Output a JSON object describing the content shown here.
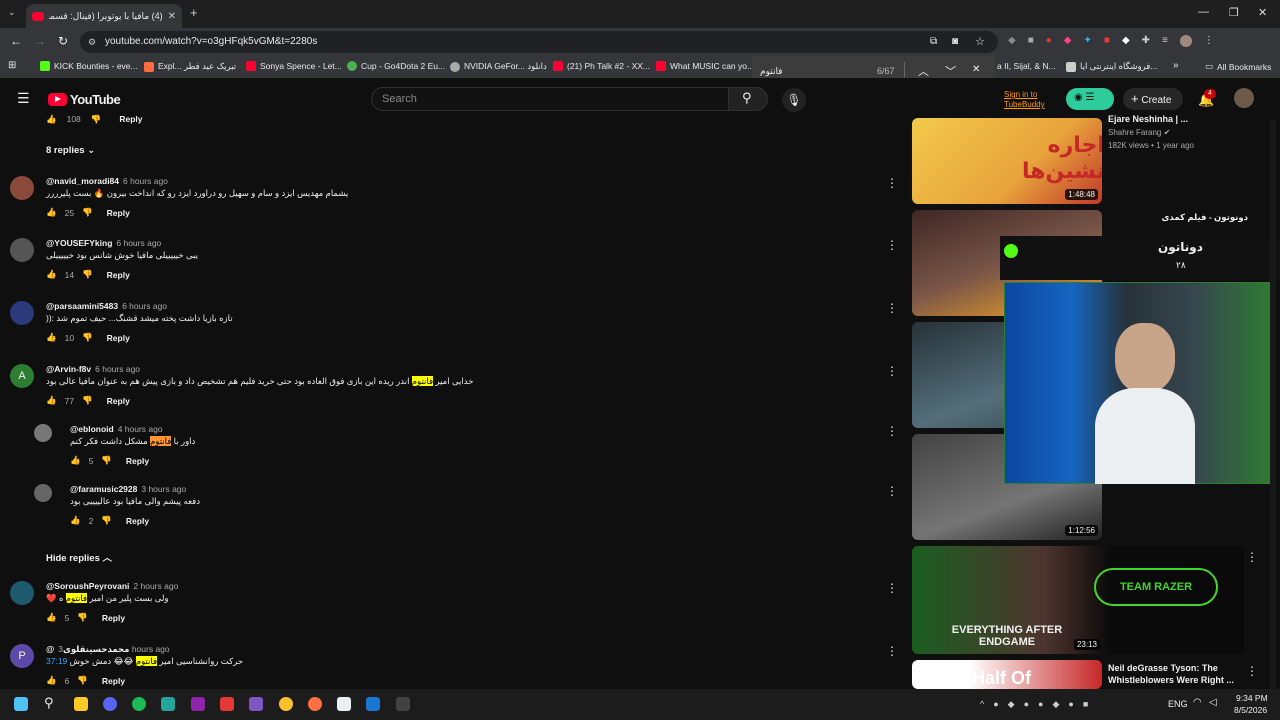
{
  "browser": {
    "tab_title": "(4) مافیا با یوتوبرا (فینال: قسمت آ...",
    "url": "youtube.com/watch?v=o3gHFqk5vGM&t=2280s",
    "bookmarks": [
      {
        "label": "KICK Bounties - eve...",
        "color": "#53fc18"
      },
      {
        "label": "Expl... تبریک عید فطر",
        "color": "#ff6b3d"
      },
      {
        "label": "Sonya Spence - Let...",
        "color": "#ff0033"
      },
      {
        "label": "Cup - Go4Dota 2 Eu...",
        "color": "#4caf50"
      },
      {
        "label": "NVIDIA GeFor... دانلود",
        "color": "#aaaaaa"
      },
      {
        "label": "(21) Ph Talk #2 - XX...",
        "color": "#ff0033"
      },
      {
        "label": "What MUSIC can yo...",
        "color": "#ff0033"
      },
      {
        "label": "a II, Sijal, & N...",
        "color": "#cccccc"
      },
      {
        "label": "فروشگاه اینترنتی ایا...",
        "color": "#cccccc"
      }
    ],
    "all_bookmarks": "All Bookmarks",
    "find": {
      "query": "فانتوم",
      "count": "6/67"
    }
  },
  "youtube": {
    "logo": "YouTube",
    "search_placeholder": "Search",
    "sign_in": "Sign in to TubeBuddy",
    "create": "Create",
    "notif_count": "4"
  },
  "comments": {
    "top_likes": "108",
    "top_reply": "Reply",
    "replies_toggle": "8 replies",
    "hide_replies": "Hide replies",
    "items": [
      {
        "user": "@navid_moradi84",
        "time": "6 hours ago",
        "text": "یشمام مهدیس ایزد و سام و سهیل رو دراورد ایزد رو که انداخت بیرون 🔥 بست پلیرررر",
        "likes": "25",
        "reply": "Reply",
        "avatar": "#8b4a3c"
      },
      {
        "user": "@YOUSEFYking",
        "time": "6 hours ago",
        "text": "یبی خیییییلی مافیا خوش شانس بود خیییییلی",
        "likes": "14",
        "reply": "Reply",
        "avatar": "#555555"
      },
      {
        "user": "@parsaamini5483",
        "time": "6 hours ago",
        "text": "تازه بازیا داشت پخته میشد قشنگ... حیف تموم شد :((",
        "likes": "10",
        "reply": "Reply",
        "avatar": "#2a3a7a"
      },
      {
        "user": "@Arvin-f8v",
        "time": "6 hours ago",
        "text_pre": "خدایی امیر ",
        "highlight": "فانتوم",
        "text_post": " اندر ریده این بازی فوق العاده بود حتی خرید فلیم هم تشخیص داد و بازی پیش هم به عنوان مافیا عالی بود",
        "likes": "77",
        "reply": "Reply",
        "avatar": "#2e7d32",
        "initial": "A"
      },
      {
        "user": "@eblonoid",
        "time": "4 hours ago",
        "text_pre": "داور با ",
        "highlight": "فانتوم",
        "text_post": " مشکل داشت فکر کنم",
        "likes": "5",
        "reply": "Reply",
        "avatar": "#777777"
      },
      {
        "user": "@faramusic2928",
        "time": "3 hours ago",
        "text": "دفعه پیشم والی مافیا بود عالییییی بود",
        "likes": "2",
        "reply": "Reply",
        "avatar": "#666666"
      },
      {
        "user": "@SoroushPeyrovani",
        "time": "2 hours ago",
        "text_pre": "ولی بست پلیر من امیر ",
        "highlight": "فانتوم",
        "text_post": " ه ❤️",
        "likes": "5",
        "reply": "Reply",
        "avatar": "#1e5a6e"
      },
      {
        "user": "@محمدحسینقلوی",
        "time": "3 hours ago",
        "text_pre": "حرکت روانشناسیی امیر ",
        "highlight": "فانتوم",
        "text_post": " 😂😂 دمش خوش",
        "timestamp_link": "37:19",
        "likes": "6",
        "reply": "Reply",
        "avatar": "#5c4aa8",
        "initial": "P"
      }
    ]
  },
  "sidebar": {
    "videos": [
      {
        "title": "Ejare Neshinha | ...",
        "channel": "Shahre Farang",
        "meta": "182K views • 1 year ago",
        "duration": "1:48:48"
      },
      {
        "title": "دونوتون - فیلم کمدی",
        "channel": "",
        "meta": "",
        "duration": ""
      },
      {
        "title": "",
        "channel": "",
        "meta": "",
        "duration": ""
      },
      {
        "title": "",
        "channel": "",
        "meta": "",
        "duration": "1:12:56"
      },
      {
        "title": "EVERYTHING AFTER ENDGAME",
        "channel": "",
        "meta": "",
        "duration": "23:13"
      },
      {
        "title": "Neil deGrasse Tyson: The Whistleblowers Were Right ...",
        "channel": "",
        "meta": "",
        "duration": ""
      }
    ],
    "overlay_title": "دوناتون",
    "overlay_sub": "۲۸",
    "team_razer": "TEAM RAZER"
  },
  "taskbar": {
    "lang": "ENG",
    "time": "9:34 PM",
    "date": "8/5/2026"
  }
}
